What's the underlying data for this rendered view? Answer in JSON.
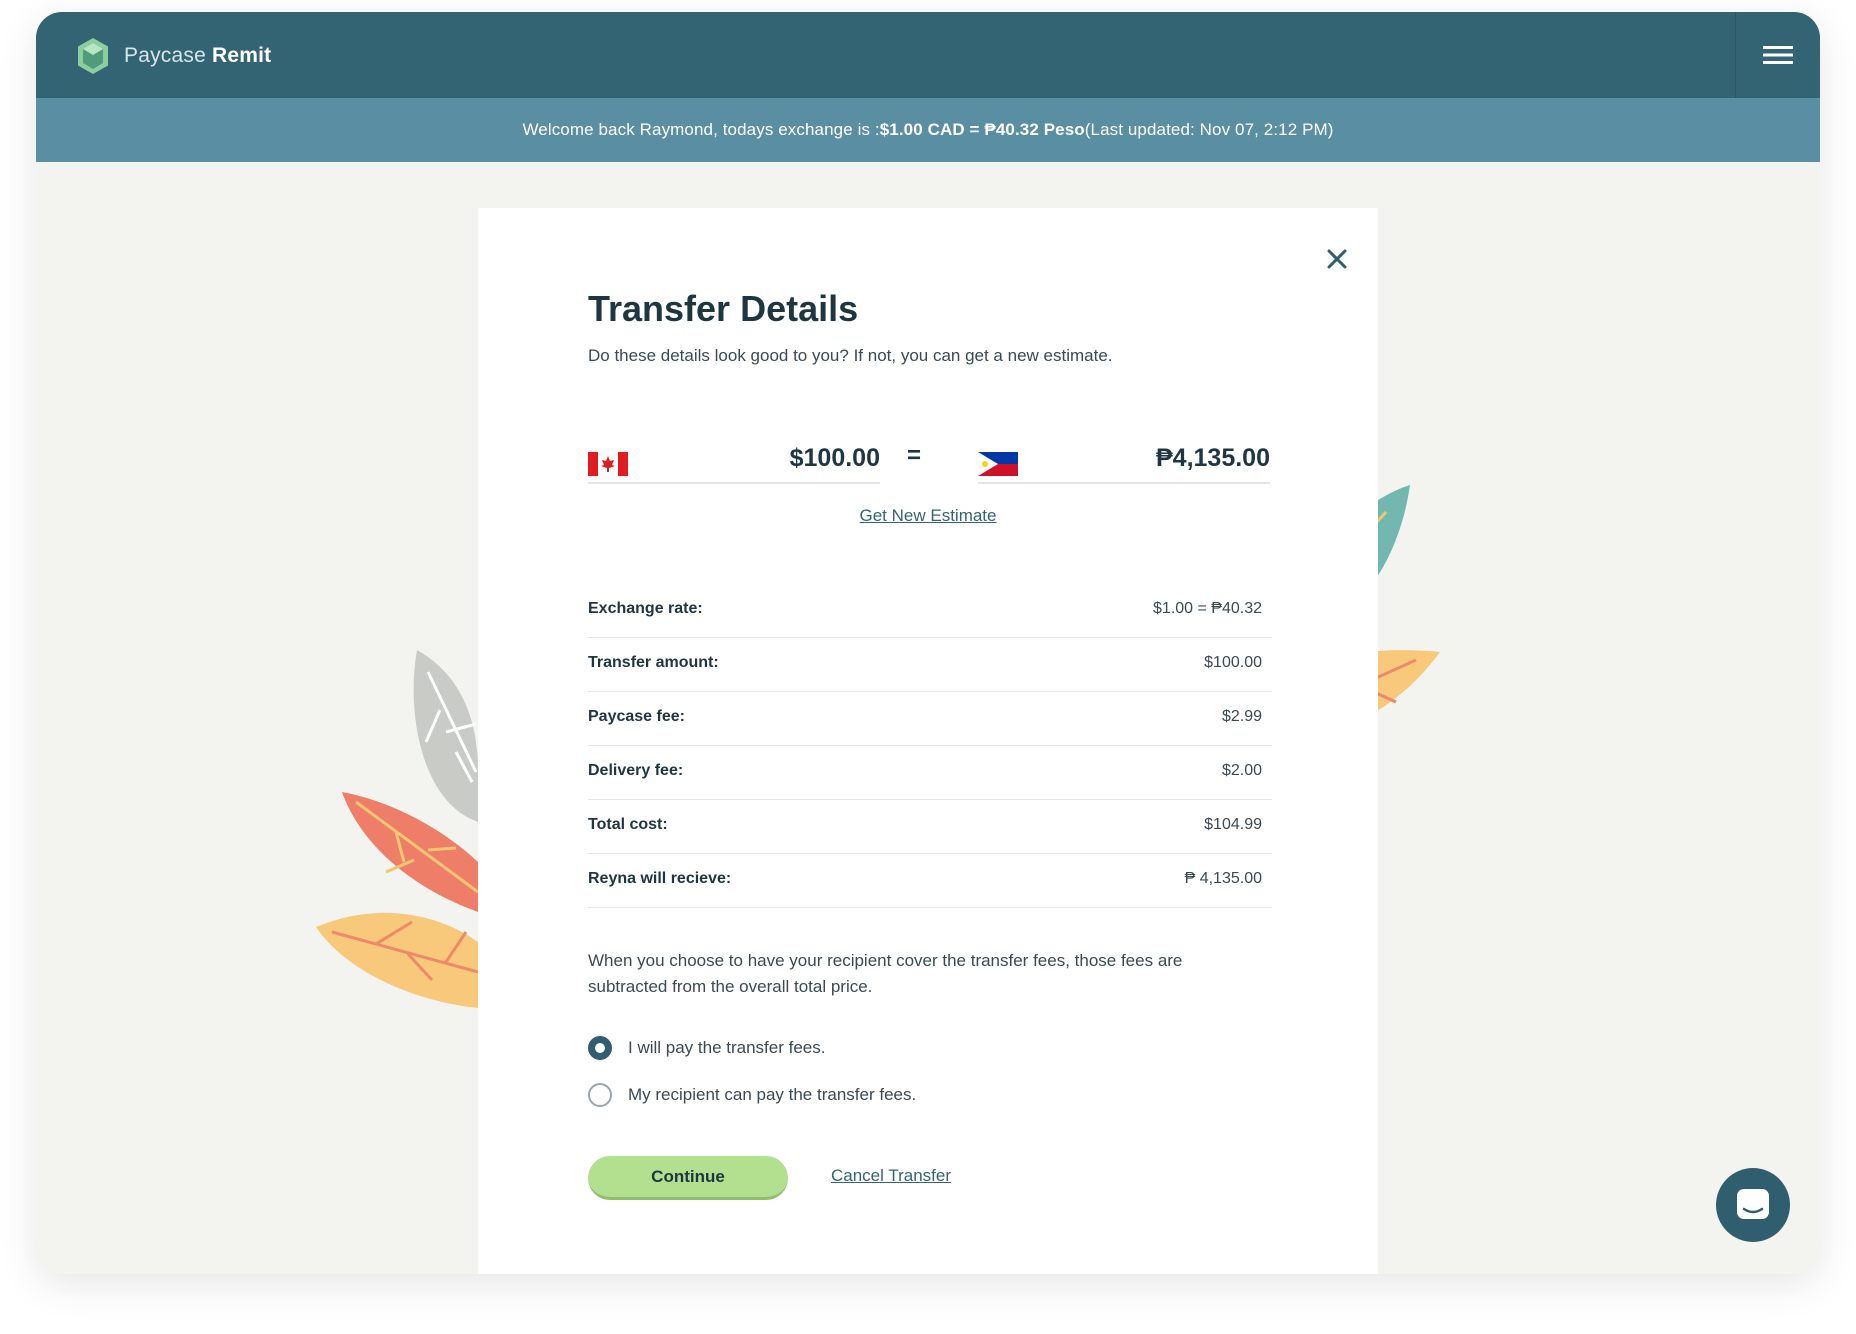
{
  "app": {
    "brand_light": "Paycase",
    "brand_bold": "Remit"
  },
  "banner": {
    "prefix": "Welcome back Raymond, todays exchange is : ",
    "rate": "$1.00 CAD = ₱40.32 Peso",
    "suffix": " (Last updated: Nov 07, 2:12 PM)"
  },
  "modal": {
    "title": "Transfer Details",
    "subtitle": "Do these details look good to you? If not, you can get a new estimate.",
    "send_amount": "$100.00",
    "equals": "=",
    "receive_amount": "₱4,135.00",
    "estimate_link": "Get New Estimate",
    "details": [
      {
        "label": "Exchange rate:",
        "value": "$1.00 = ₱40.32"
      },
      {
        "label": "Transfer amount:",
        "value": "$100.00"
      },
      {
        "label": "Paycase fee:",
        "value": "$2.99"
      },
      {
        "label": "Delivery fee:",
        "value": "$2.00"
      },
      {
        "label": "Total cost:",
        "value": "$104.99"
      },
      {
        "label": "Reyna will recieve:",
        "value": "₱ 4,135.00"
      }
    ],
    "note": "When you choose to have your recipient cover the transfer fees, those fees are subtracted from the overall total price.",
    "options": [
      {
        "label": "I will pay the transfer fees.",
        "checked": true
      },
      {
        "label": "My recipient can pay the transfer fees.",
        "checked": false
      }
    ],
    "continue_label": "Continue",
    "cancel_label": "Cancel Transfer"
  },
  "colors": {
    "navbar": "#336474",
    "banner": "#5a8ea2",
    "accent_green": "#b3e08e",
    "background": "#f3f4f0"
  },
  "icons": {
    "logo": "paycase-hexagon-logo-icon",
    "menu": "hamburger-menu-icon",
    "close": "close-icon",
    "chat": "chat-bubble-icon",
    "send_flag": "canada-flag-icon",
    "receive_flag": "philippines-flag-icon"
  }
}
